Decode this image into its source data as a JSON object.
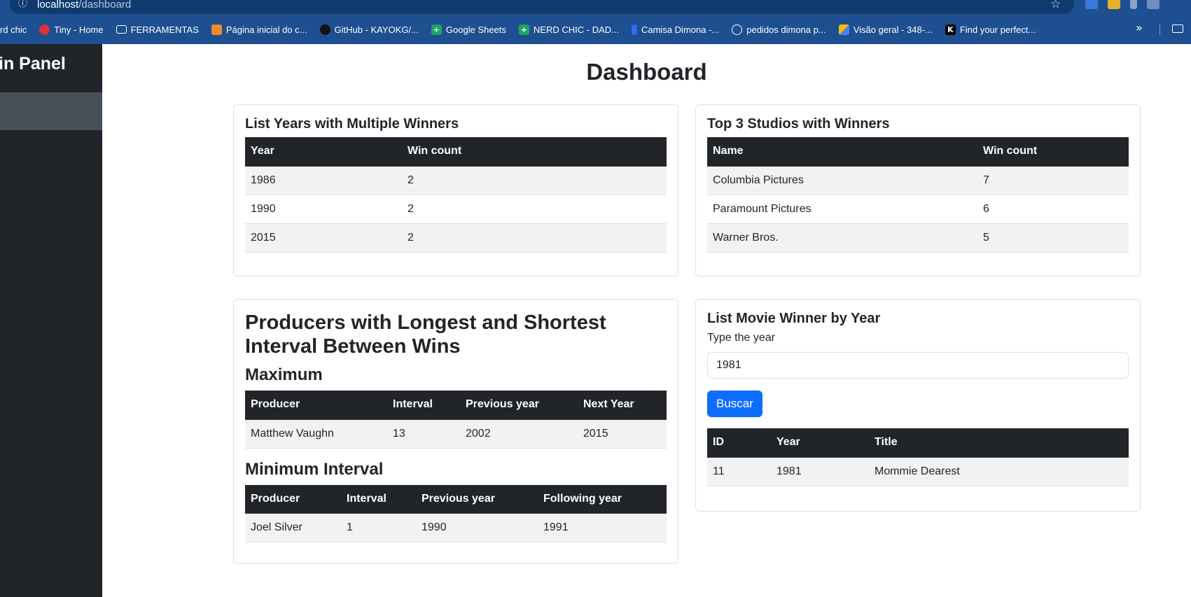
{
  "browser": {
    "url_host": "localhost",
    "url_path": "/dashboard",
    "bookmarks": [
      {
        "label": "rd chic",
        "icon": "none"
      },
      {
        "label": "Tiny - Home",
        "icon": "tiny-icon"
      },
      {
        "label": "FERRAMENTAS",
        "icon": "folder-icon"
      },
      {
        "label": "Página inicial do c...",
        "icon": "cube-icon"
      },
      {
        "label": "GitHub - KAYOKG/...",
        "icon": "github-icon"
      },
      {
        "label": "Google Sheets",
        "icon": "sheets-icon"
      },
      {
        "label": "NERD CHIC - DAD...",
        "icon": "sheets-icon"
      },
      {
        "label": "Camisa Dimona -...",
        "icon": "dimona-icon"
      },
      {
        "label": "pedidos dimona p...",
        "icon": "globe-icon"
      },
      {
        "label": "Visão geral - 348-...",
        "icon": "ads-icon"
      },
      {
        "label": "Find your perfect...",
        "icon": "k-icon"
      }
    ]
  },
  "sidebar": {
    "title": "in Panel"
  },
  "page": {
    "title": "Dashboard"
  },
  "multiple_winners": {
    "title": "List Years with Multiple Winners",
    "headers": [
      "Year",
      "Win count"
    ],
    "rows": [
      [
        "1986",
        "2"
      ],
      [
        "1990",
        "2"
      ],
      [
        "2015",
        "2"
      ]
    ]
  },
  "top_studios": {
    "title": "Top 3 Studios with Winners",
    "headers": [
      "Name",
      "Win count"
    ],
    "rows": [
      [
        "Columbia Pictures",
        "7"
      ],
      [
        "Paramount Pictures",
        "6"
      ],
      [
        "Warner Bros.",
        "5"
      ]
    ]
  },
  "intervals": {
    "title": "Producers with Longest and Shortest Interval Between Wins",
    "max_title": "Maximum",
    "max_headers": [
      "Producer",
      "Interval",
      "Previous year",
      "Next Year"
    ],
    "max_rows": [
      [
        "Matthew Vaughn",
        "13",
        "2002",
        "2015"
      ]
    ],
    "min_title": "Minimum Interval",
    "min_headers": [
      "Producer",
      "Interval",
      "Previous year",
      "Following year"
    ],
    "min_rows": [
      [
        "Joel Silver",
        "1",
        "1990",
        "1991"
      ]
    ]
  },
  "winner_by_year": {
    "title": "List Movie Winner by Year",
    "label": "Type the year",
    "input_value": "1981",
    "button_label": "Buscar",
    "headers": [
      "ID",
      "Year",
      "Title"
    ],
    "rows": [
      [
        "11",
        "1981",
        "Mommie Dearest"
      ]
    ]
  },
  "colors": {
    "browser_bar": "#1d4f91",
    "sidebar": "#212529",
    "sidebar_active": "#495057",
    "table_header": "#212529",
    "primary_button": "#0d6efd"
  }
}
